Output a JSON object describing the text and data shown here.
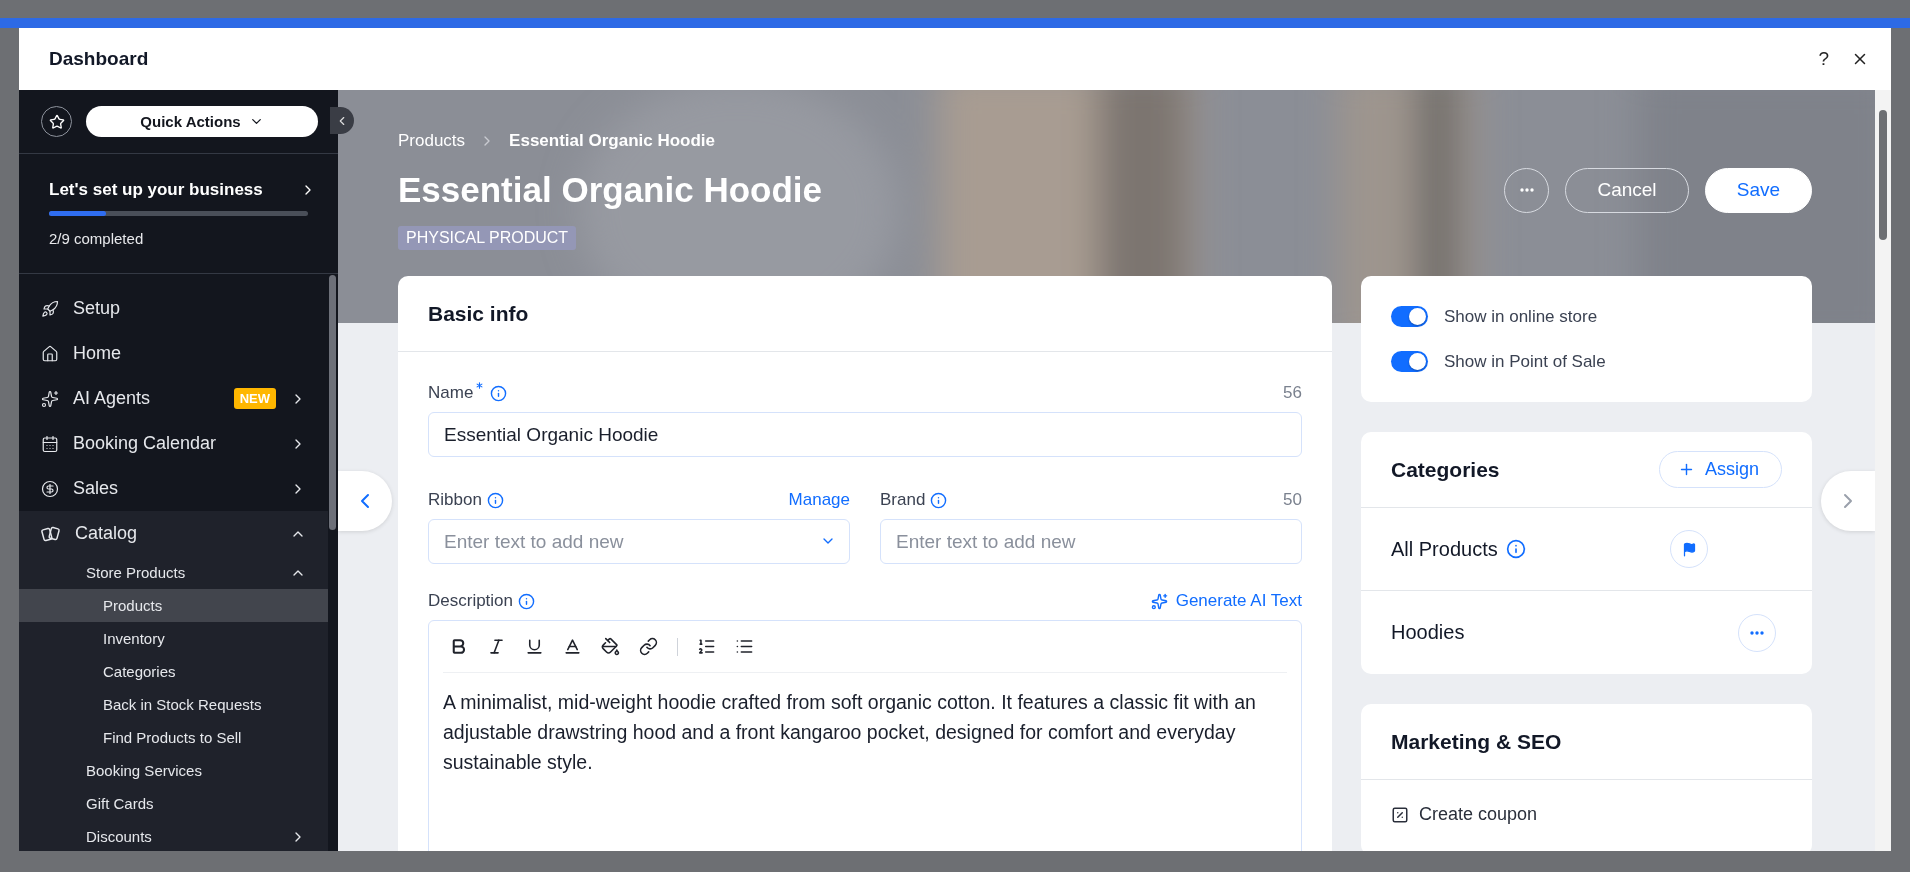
{
  "window": {
    "title": "Dashboard",
    "help": "?"
  },
  "sidebar": {
    "quick_actions": "Quick Actions",
    "setup": {
      "title": "Let's set up your business",
      "level": 0.22,
      "progress": "2/9 completed"
    },
    "items": [
      {
        "label": "Setup",
        "selected": false
      },
      {
        "label": "Home",
        "selected": false
      },
      {
        "label": "AI Agents",
        "badge": "NEW",
        "expanded": false,
        "selected": false
      },
      {
        "label": "Booking Calendar",
        "expanded": false,
        "selected": false
      },
      {
        "label": "Sales",
        "expanded": false,
        "selected": false
      },
      {
        "label": "Catalog",
        "expanded": true,
        "selected": false,
        "children": [
          {
            "label": "Store Products",
            "expanded": true,
            "selected": false,
            "children": [
              {
                "label": "Products",
                "selected": true
              },
              {
                "label": "Inventory",
                "selected": false
              },
              {
                "label": "Categories",
                "selected": false
              },
              {
                "label": "Back in Stock Requests",
                "selected": false
              },
              {
                "label": "Find Products to Sell",
                "selected": false
              }
            ]
          },
          {
            "label": "Booking Services",
            "selected": false
          },
          {
            "label": "Gift Cards",
            "selected": false
          },
          {
            "label": "Discounts",
            "expanded": false,
            "selected": false
          }
        ]
      }
    ]
  },
  "header": {
    "breadcrumb": [
      "Products",
      "Essential Organic Hoodie"
    ],
    "title": "Essential Organic Hoodie",
    "tag": "PHYSICAL PRODUCT",
    "buttons": {
      "cancel": "Cancel",
      "save": "Save"
    }
  },
  "basic_info": {
    "title": "Basic info",
    "name": {
      "label": "Name",
      "required": true,
      "counter": "56",
      "value": "Essential Organic Hoodie"
    },
    "ribbon": {
      "label": "Ribbon",
      "link": "Manage",
      "placeholder": "Enter text to add new"
    },
    "brand": {
      "label": "Brand",
      "counter": "50",
      "placeholder": "Enter text to add new"
    },
    "description": {
      "label": "Description",
      "link": "Generate AI Text",
      "text": "A minimalist, mid-weight hoodie crafted from soft organic cotton. It features a classic fit with an adjustable drawstring hood and a front kangaroo pocket, designed for comfort and everyday sustainable style."
    }
  },
  "visibility": {
    "toggles": [
      {
        "label": "Show in online store",
        "on": true
      },
      {
        "label": "Show in Point of Sale",
        "on": true
      }
    ]
  },
  "categories": {
    "title": "Categories",
    "assign": "Assign",
    "items": [
      {
        "label": "All Products",
        "kind": "main"
      },
      {
        "label": "Hoodies",
        "kind": "custom"
      }
    ]
  },
  "marketing": {
    "title": "Marketing & SEO",
    "actions": [
      "Create coupon"
    ]
  }
}
